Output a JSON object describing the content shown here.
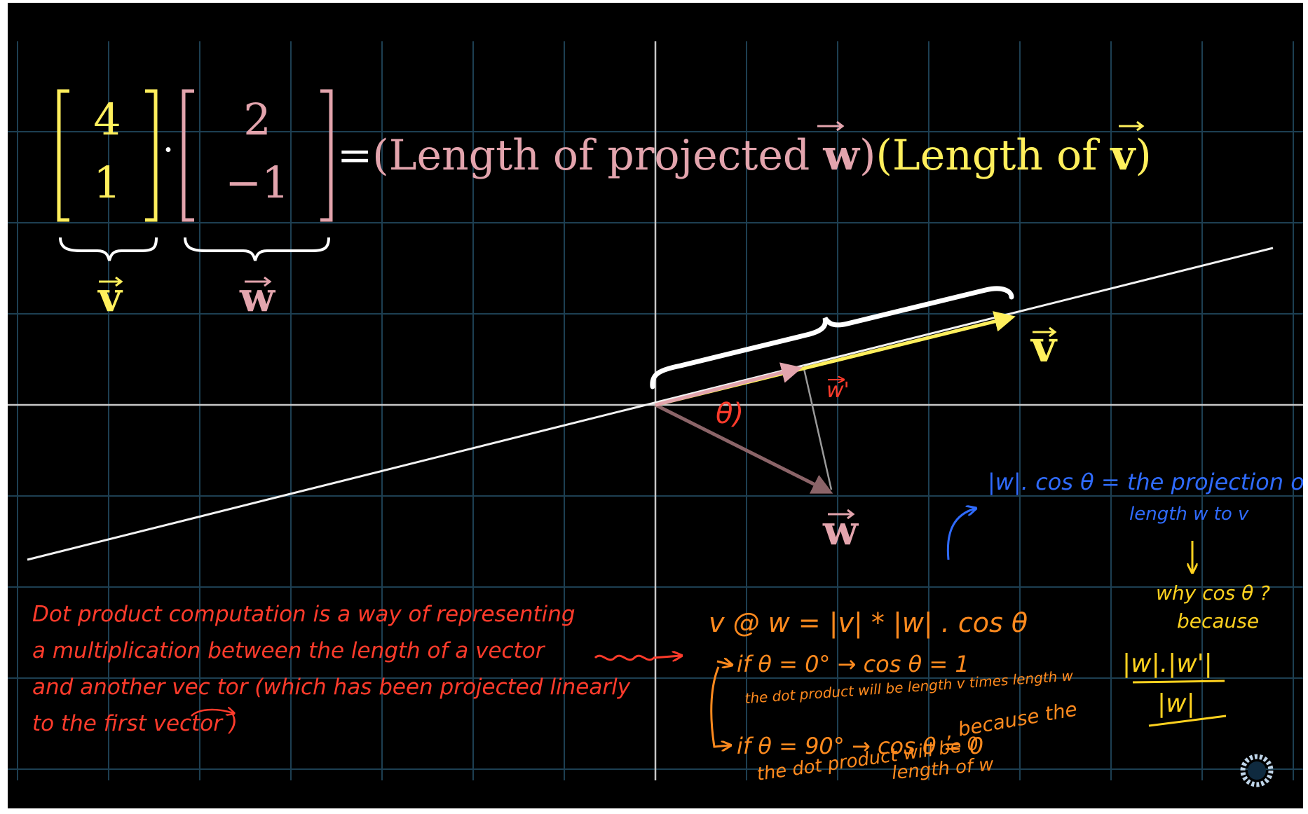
{
  "colors": {
    "background": "#000000",
    "grid": "#1d3f52",
    "axis": "#c8c8c8",
    "vector_v": "#ffef5c",
    "vector_w": "#e3a4ad",
    "white": "#ffffff",
    "note_red": "#ff3b2b",
    "note_orange": "#ff8a1e",
    "note_blue": "#2f6bff",
    "note_yellow": "#ffd21f"
  },
  "equation": {
    "v_top": "4",
    "v_bottom": "1",
    "dot": "·",
    "w_top": "2",
    "w_bottom": "−1",
    "equals": "=",
    "term1_open": "(Length of projected ",
    "term1_vec": "w",
    "term1_close": ")",
    "term2_open": "(Length of ",
    "term2_vec": "v",
    "term2_close": ")",
    "brace_label_v": "v",
    "brace_label_w": "w"
  },
  "diagram": {
    "label_v": "v",
    "label_w": "w",
    "label_w_prime": "w'",
    "label_theta": "θ)",
    "vector_v_coords": [
      4,
      1
    ],
    "vector_w_coords": [
      2,
      -1
    ]
  },
  "notes": {
    "red": [
      "Dot product computation is a way of representing",
      "a multiplication between the length of a vector",
      "and another vec tor (which has been projected linearly",
      "to the first vector )"
    ],
    "orange": {
      "formula": "v @ w = |v| * |w| . cos θ",
      "case1_condition": "if θ = 0° → cos θ = 1",
      "case1_result": "the dot product will be length v times length w",
      "case2_condition": "if θ = 90° → cos θ = 0",
      "case2_reason": ", because the",
      "case2_result": "the dot product will be 0",
      "case2_length": "length of w"
    },
    "blue": {
      "line1": "|w|. cos θ = the projection of",
      "line2": "length w to v"
    },
    "yellow": {
      "question": "why cos θ ?",
      "because": "because",
      "numerator": "|w|.|w'|",
      "denominator": "|w|"
    }
  }
}
